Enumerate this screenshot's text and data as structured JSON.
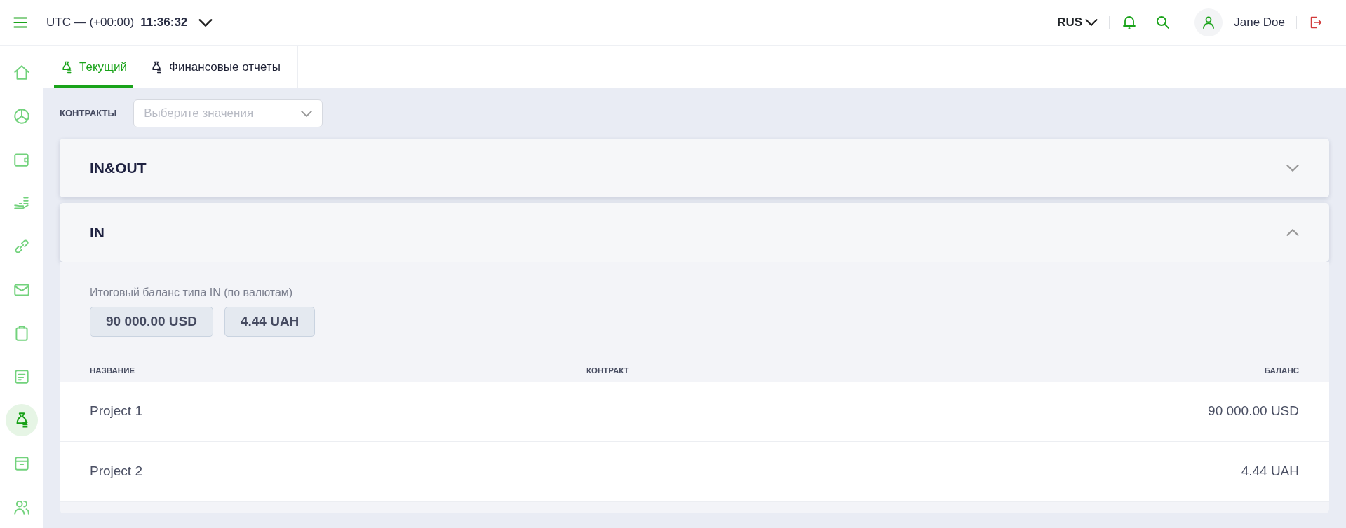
{
  "header": {
    "timezone": "UTC — (+00:00)",
    "time": "11:36:32",
    "language": "RUS",
    "user": "Jane Doe"
  },
  "sidebar": {
    "items": [
      {
        "selected": false
      },
      {
        "selected": false
      },
      {
        "selected": false
      },
      {
        "selected": false
      },
      {
        "selected": false
      },
      {
        "selected": false
      },
      {
        "selected": false
      },
      {
        "selected": false
      },
      {
        "selected": true
      },
      {
        "selected": false
      },
      {
        "selected": false
      }
    ]
  },
  "tabs": [
    {
      "label": "Текущий",
      "selected": true
    },
    {
      "label": "Финансовые отчеты",
      "selected": false
    }
  ],
  "filter": {
    "label": "КОНТРАКТЫ",
    "placeholder": "Выберите значения"
  },
  "sections": [
    {
      "title": "IN&OUT",
      "expanded": false
    },
    {
      "title": "IN",
      "expanded": true,
      "summary_label": "Итоговый баланс типа IN (по валютам)",
      "totals": [
        "90 000.00 USD",
        "4.44 UAH"
      ],
      "table": {
        "columns": [
          "НАЗВАНИЕ",
          "КОНТРАКТ",
          "БАЛАНС"
        ],
        "rows": [
          {
            "name": "Project 1",
            "balance": "90 000.00 USD"
          },
          {
            "name": "Project 2",
            "balance": "4.44 UAH"
          }
        ]
      }
    }
  ]
}
